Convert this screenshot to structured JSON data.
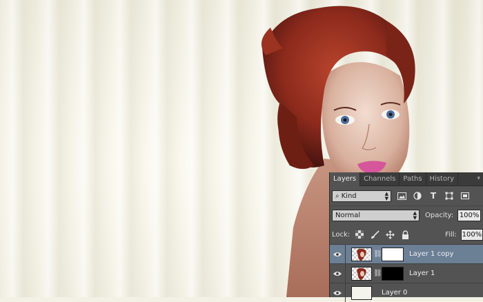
{
  "panel": {
    "tabs": [
      {
        "label": "Layers",
        "active": true
      },
      {
        "label": "Channels",
        "active": false
      },
      {
        "label": "Paths",
        "active": false
      },
      {
        "label": "History",
        "active": false
      }
    ],
    "filter": {
      "kind_label": "Kind",
      "kind_icon": "search-icon",
      "icons": [
        "image-filter-icon",
        "adjustment-filter-icon",
        "type-filter-icon",
        "shape-filter-icon",
        "smart-object-filter-icon"
      ]
    },
    "blend_mode": "Normal",
    "opacity_label": "Opacity:",
    "opacity_value": "100%",
    "lock_label": "Lock:",
    "lock_icons": [
      "lock-transparent-icon",
      "lock-paint-icon",
      "lock-position-icon",
      "lock-all-icon"
    ],
    "fill_label": "Fill:",
    "fill_value": "100%",
    "layers": [
      {
        "name": "Layer 1 copy",
        "selected": true,
        "visible": true,
        "mask": "white"
      },
      {
        "name": "Layer 1",
        "selected": false,
        "visible": true,
        "mask": "black"
      },
      {
        "name": "Layer 0",
        "selected": false,
        "visible": true,
        "mask": null
      }
    ]
  },
  "colors": {
    "panel_bg": "#535353",
    "selected_row": "#6b7f95",
    "hair": "#8c2a1c"
  }
}
